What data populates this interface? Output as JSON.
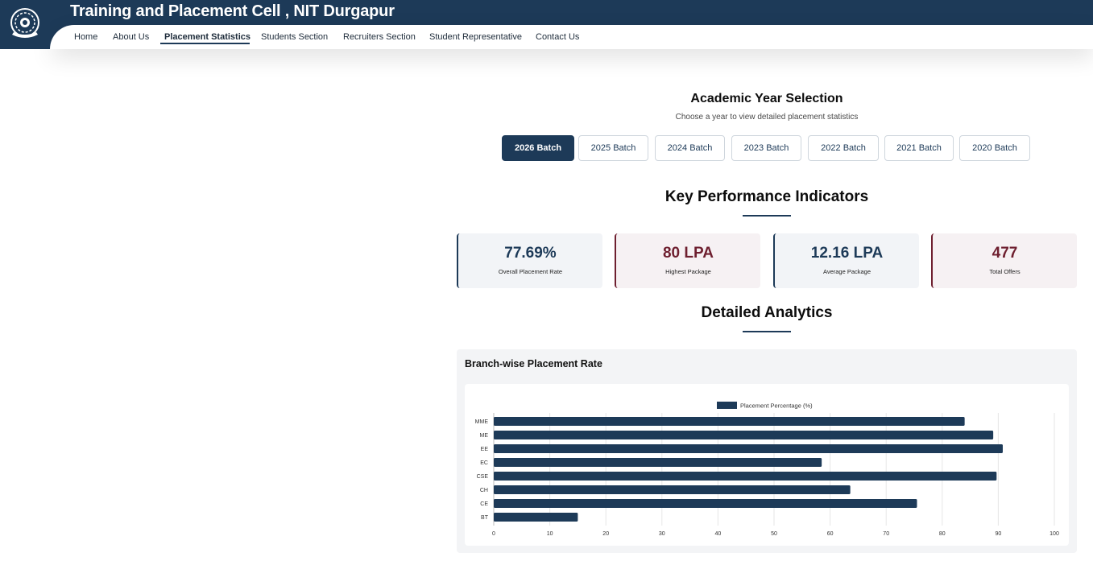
{
  "header": {
    "title": "Training and Placement Cell , NIT Durgapur",
    "logo_icon": "nit-durgapur-emblem-icon"
  },
  "nav": {
    "items": [
      {
        "label": "Home"
      },
      {
        "label": "About Us"
      },
      {
        "label": "Placement Statistics",
        "active": true
      },
      {
        "label": "Students Section"
      },
      {
        "label": "Recruiters Section"
      },
      {
        "label": "Student Representative"
      },
      {
        "label": "Contact Us"
      }
    ]
  },
  "year_selection": {
    "title": "Academic Year Selection",
    "subtitle": "Choose a year to view detailed placement statistics",
    "batches": [
      {
        "label": "2026 Batch",
        "active": true
      },
      {
        "label": "2025 Batch"
      },
      {
        "label": "2024 Batch"
      },
      {
        "label": "2023 Batch"
      },
      {
        "label": "2022 Batch"
      },
      {
        "label": "2021 Batch"
      },
      {
        "label": "2020 Batch"
      }
    ]
  },
  "kpi": {
    "title": "Key Performance Indicators",
    "cards": [
      {
        "value": "77.69%",
        "label": "Overall Placement Rate"
      },
      {
        "value": "80 LPA",
        "label": "Highest Package"
      },
      {
        "value": "12.16 LPA",
        "label": "Average Package"
      },
      {
        "value": "477",
        "label": "Total Offers"
      }
    ]
  },
  "analytics": {
    "title": "Detailed Analytics",
    "panel_title": "Branch-wise Placement Rate"
  },
  "colors": {
    "primary": "#1d3a58",
    "accent": "#6e1f2f"
  },
  "chart_data": {
    "type": "bar",
    "orientation": "horizontal",
    "categories": [
      "MME",
      "ME",
      "EE",
      "EC",
      "CSE",
      "CH",
      "CE",
      "BT"
    ],
    "series": [
      {
        "name": "Placement Percentage (%)",
        "values": [
          84,
          89.1,
          90.8,
          58.5,
          89.7,
          63.6,
          75.5,
          15
        ]
      }
    ],
    "xlim": [
      0,
      100
    ],
    "xticks": [
      "0",
      "10",
      "20",
      "30",
      "40",
      "50",
      "60",
      "70",
      "80",
      "90",
      "100"
    ],
    "legend": "top-center",
    "grid": true
  }
}
